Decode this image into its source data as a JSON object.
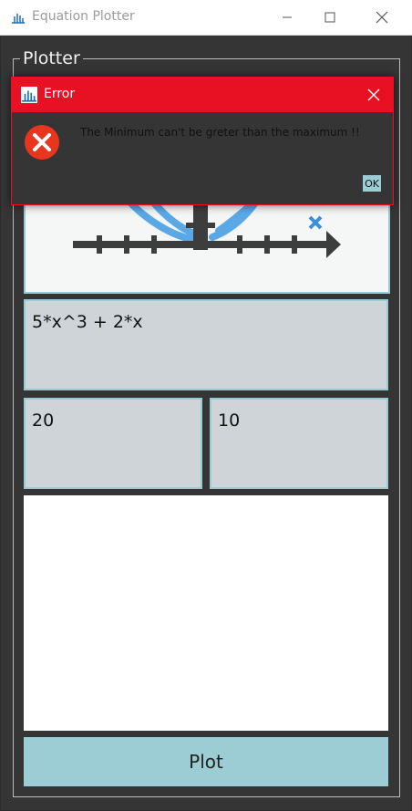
{
  "window": {
    "title": "Equation Plotter",
    "icon": "plot-app-icon",
    "minimize_icon": "minimize-icon",
    "maximize_icon": "maximize-icon",
    "close_icon": "close-icon"
  },
  "group": {
    "label": "Plotter"
  },
  "equation": {
    "value": "5*x^3 + 2*x"
  },
  "range": {
    "min_value": "20",
    "max_value": "10"
  },
  "plot_button": {
    "label": "Plot"
  },
  "dialog": {
    "title": "Error",
    "message": "The Minimum can't be greter than the maximum !!",
    "ok_label": "OK",
    "icon": "error-icon"
  },
  "colors": {
    "accent": "#9ccdd4",
    "field": "#ced4d7",
    "background": "#353535",
    "error": "#e81123"
  }
}
